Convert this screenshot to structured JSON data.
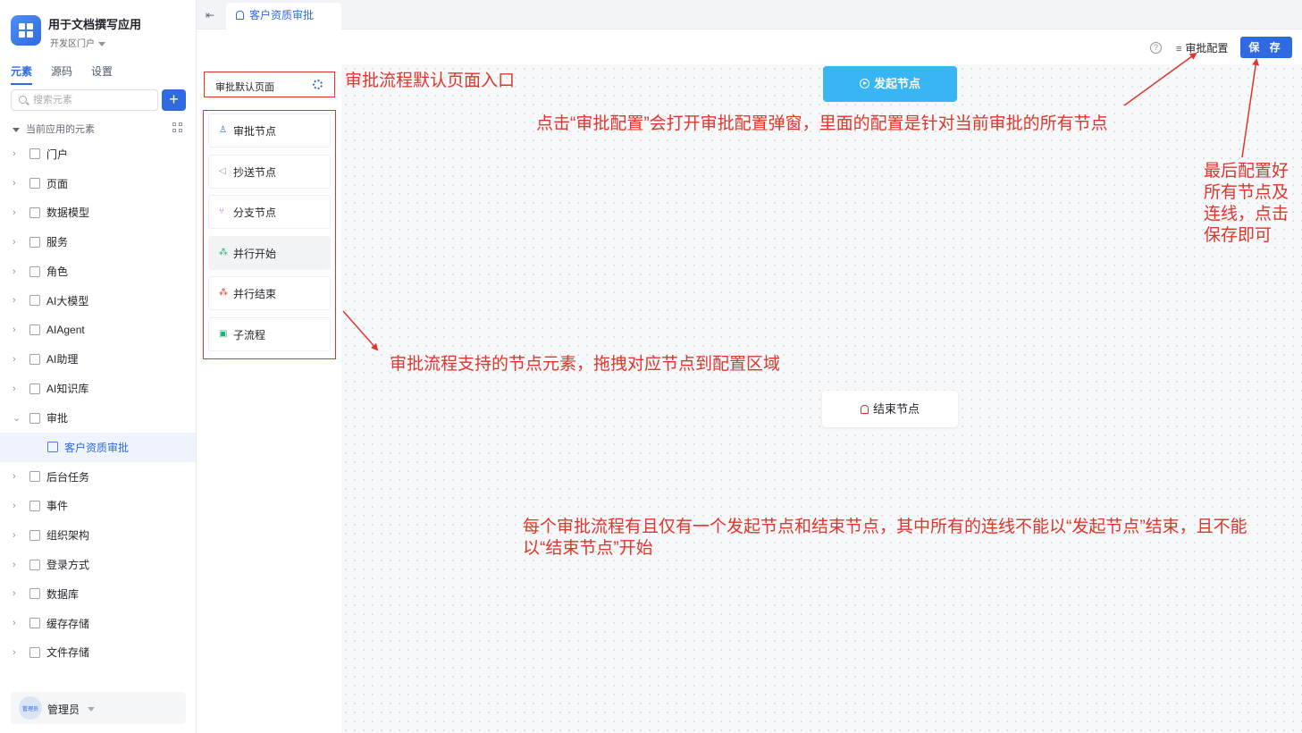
{
  "app": {
    "title": "用于文档撰写应用",
    "portal": "开发区门户"
  },
  "sidebar": {
    "tabs": [
      {
        "label": "元素",
        "active": true
      },
      {
        "label": "源码",
        "active": false
      },
      {
        "label": "设置",
        "active": false
      }
    ],
    "search_placeholder": "搜索元素",
    "add_icon": "plus-icon",
    "tree_header": "当前应用的元素",
    "items": [
      {
        "label": "门户",
        "icon": "home-icon"
      },
      {
        "label": "页面",
        "icon": "page-icon"
      },
      {
        "label": "数据模型",
        "icon": "table-icon"
      },
      {
        "label": "服务",
        "icon": "service-icon"
      },
      {
        "label": "角色",
        "icon": "role-icon"
      },
      {
        "label": "AI大模型",
        "icon": "cube-icon"
      },
      {
        "label": "AIAgent",
        "icon": "robot-icon"
      },
      {
        "label": "AI助理",
        "icon": "ai-icon"
      },
      {
        "label": "AI知识库",
        "icon": "book-icon"
      },
      {
        "label": "审批",
        "icon": "approval-icon",
        "expanded": true
      },
      {
        "label": "客户资质审批",
        "icon": "approval-icon",
        "child": true,
        "selected": true
      },
      {
        "label": "后台任务",
        "icon": "task-icon"
      },
      {
        "label": "事件",
        "icon": "event-icon"
      },
      {
        "label": "组织架构",
        "icon": "org-icon"
      },
      {
        "label": "登录方式",
        "icon": "login-icon"
      },
      {
        "label": "数据库",
        "icon": "database-icon"
      },
      {
        "label": "缓存存储",
        "icon": "cache-icon"
      },
      {
        "label": "文件存储",
        "icon": "folder-icon"
      }
    ],
    "user": {
      "name": "管理员",
      "avatar_text": "管理员"
    }
  },
  "tabbar": {
    "active_tab": "客户资质审批"
  },
  "toolbar": {
    "config_label": "审批配置",
    "save_label": "保 存"
  },
  "panel": {
    "default_page": "审批默认页面",
    "nodes": [
      {
        "label": "审批节点",
        "icon": "approval-node-icon",
        "color": "#2f6ae0"
      },
      {
        "label": "抄送节点",
        "icon": "send-icon",
        "color": "#8f959e"
      },
      {
        "label": "分支节点",
        "icon": "branch-icon",
        "color": "#b05cd6"
      },
      {
        "label": "并行开始",
        "icon": "parallel-start-icon",
        "color": "#20b26b"
      },
      {
        "label": "并行结束",
        "icon": "parallel-end-icon",
        "color": "#e0352b"
      },
      {
        "label": "子流程",
        "icon": "subflow-icon",
        "color": "#20b26b"
      }
    ]
  },
  "flow": {
    "start_node": "发起节点",
    "end_node": "结束节点"
  },
  "annotations": {
    "default_entry": "审批流程默认页面入口",
    "config_hint": "点击“审批配置”会打开审批配置弹窗，里面的配置是针对当前审批的所有节点",
    "save_hint": [
      "最后配置好",
      "所有节点及",
      "连线，点击",
      "保存即可"
    ],
    "nodes_hint": "审批流程支持的节点元素，拖拽对应节点到配置区域",
    "rule_hint": [
      "每个审批流程有且仅有一个发起节点和结束节点，其中所有的连线不能以“发起节点”结束，且不能",
      "以“结束节点”开始"
    ]
  },
  "colors": {
    "accent": "#2f6ae0",
    "start_node": "#38b6f4",
    "annotation": "#e0352b"
  }
}
